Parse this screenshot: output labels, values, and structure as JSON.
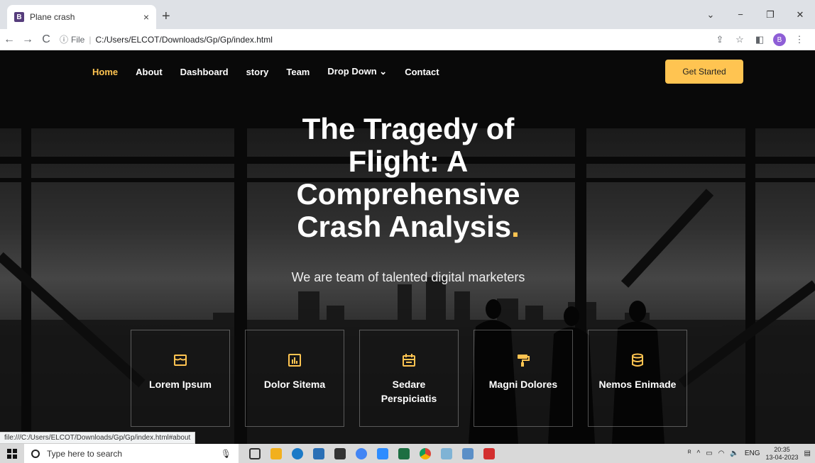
{
  "browser": {
    "tab": {
      "favicon": "B",
      "title": "Plane crash",
      "close": "×"
    },
    "new_tab": "+",
    "window_controls": {
      "minimize": "⌄",
      "restore": "−",
      "maximize": "❐",
      "close": "✕"
    },
    "address": {
      "info_icon": "ⓘ",
      "scheme": "File",
      "separator": "|",
      "url": "C:/Users/ELCOT/Downloads/Gp/Gp/index.html"
    },
    "profile_initial": "B"
  },
  "nav": {
    "items": [
      {
        "label": "Home",
        "active": true
      },
      {
        "label": "About",
        "active": false
      },
      {
        "label": "Dashboard",
        "active": false
      },
      {
        "label": "story",
        "active": false
      },
      {
        "label": "Team",
        "active": false
      },
      {
        "label": "Drop Down ⌄",
        "active": false
      },
      {
        "label": "Contact",
        "active": false
      }
    ],
    "cta": "Get Started"
  },
  "hero": {
    "title_line1": "The Tragedy of",
    "title_line2": "Flight: A",
    "title_line3": "Comprehensive",
    "title_line4": "Crash Analysis",
    "title_dot": ".",
    "subtitle": "We are team of talented digital marketers"
  },
  "features": [
    {
      "label": "Lorem Ipsum",
      "icon": "store-icon"
    },
    {
      "label": "Dolor Sitema",
      "icon": "bar-chart-icon"
    },
    {
      "label": "Sedare Perspiciatis",
      "icon": "calendar-icon"
    },
    {
      "label": "Magni Dolores",
      "icon": "paint-roller-icon"
    },
    {
      "label": "Nemos Enimade",
      "icon": "database-icon"
    }
  ],
  "status_url": "file:///C:/Users/ELCOT/Downloads/Gp/Gp/index.html#about",
  "taskbar": {
    "search_placeholder": "Type here to search",
    "tray": {
      "lang": "ENG",
      "time": "20:35",
      "date": "13-04-2023"
    }
  },
  "colors": {
    "accent": "#ffc451"
  }
}
